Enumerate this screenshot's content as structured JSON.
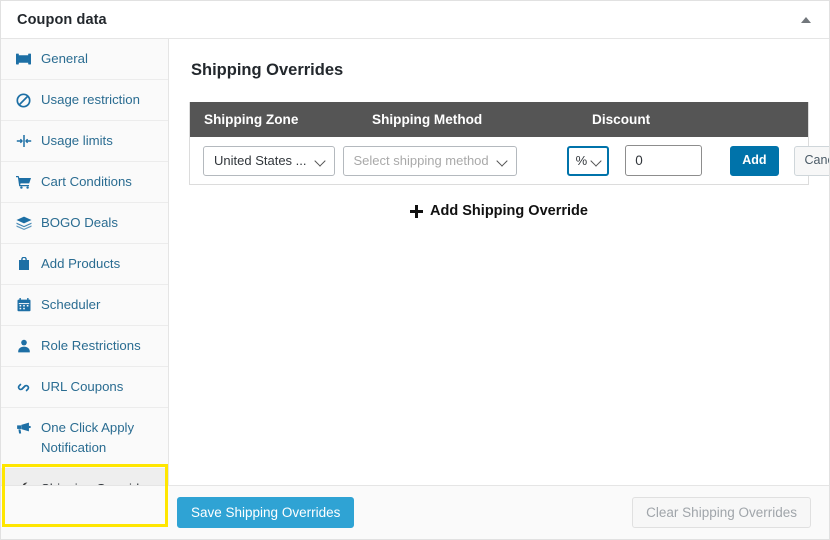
{
  "header": {
    "title": "Coupon data",
    "collapse_icon": "caret-up-icon"
  },
  "sidebar": {
    "items": [
      {
        "label": "General",
        "icon": "ticket-icon",
        "active": false
      },
      {
        "label": "Usage restriction",
        "icon": "ban-icon",
        "active": false
      },
      {
        "label": "Usage limits",
        "icon": "limits-icon",
        "active": false
      },
      {
        "label": "Cart Conditions",
        "icon": "cart-icon",
        "active": false
      },
      {
        "label": "BOGO Deals",
        "icon": "stack-icon",
        "active": false
      },
      {
        "label": "Add Products",
        "icon": "bag-icon",
        "active": false
      },
      {
        "label": "Scheduler",
        "icon": "calendar-icon",
        "active": false
      },
      {
        "label": "Role Restrictions",
        "icon": "user-icon",
        "active": false
      },
      {
        "label": "URL Coupons",
        "icon": "link-icon",
        "active": false
      },
      {
        "label": "One Click Apply Notification",
        "icon": "megaphone-icon",
        "active": false
      },
      {
        "label": "Shipping Overrides",
        "icon": "wrench-icon",
        "active": true
      }
    ]
  },
  "main": {
    "section_title": "Shipping Overrides",
    "table": {
      "columns": [
        "Shipping Zone",
        "Shipping Method",
        "Discount"
      ],
      "row": {
        "zone_value": "United States ...",
        "method_placeholder": "Select shipping method",
        "discount_type": "%",
        "discount_value": "0",
        "add_label": "Add",
        "cancel_label": "Cancel"
      }
    },
    "add_override_label": "Add Shipping Override",
    "add_override_icon": "plus-icon"
  },
  "footer": {
    "save_label": "Save Shipping Overrides",
    "clear_label": "Clear Shipping Overrides"
  },
  "colors": {
    "accent_blue": "#0073aa",
    "save_blue": "#2fa3d4",
    "table_header": "#555555",
    "highlight_yellow": "#ffe600",
    "link_blue": "#2a6c91"
  }
}
